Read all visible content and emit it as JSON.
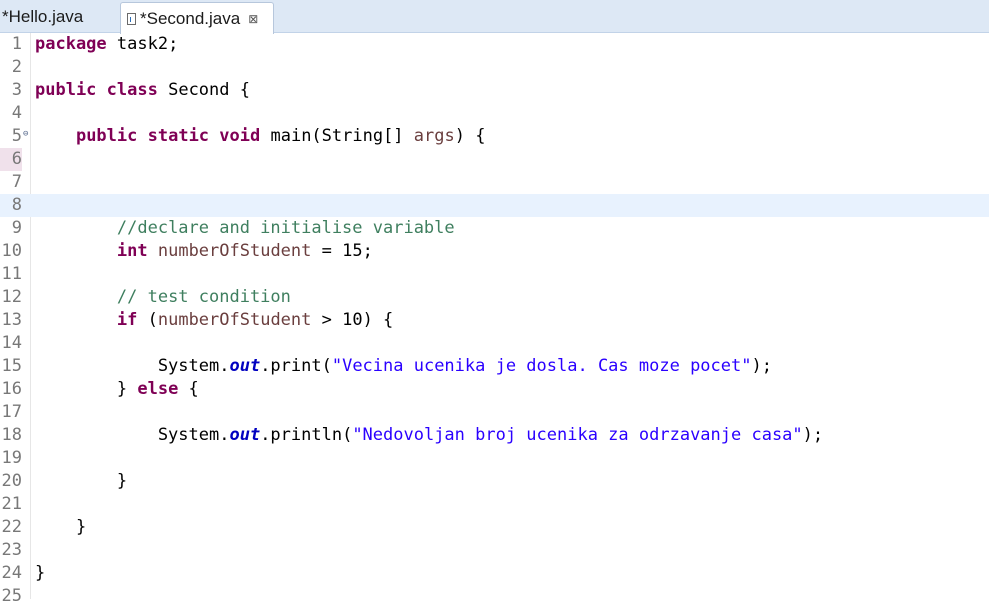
{
  "tabs": [
    {
      "label": "*Hello.java",
      "active": false
    },
    {
      "label": "*Second.java",
      "active": true,
      "close_glyph": "⊠"
    }
  ],
  "current_line": 8,
  "lines": [
    {
      "n": "1",
      "tokens": [
        {
          "t": "package",
          "c": "kw"
        },
        {
          "t": " task2;"
        }
      ]
    },
    {
      "n": "2",
      "tokens": []
    },
    {
      "n": "3",
      "tokens": [
        {
          "t": "public",
          "c": "kw"
        },
        {
          "t": " "
        },
        {
          "t": "class",
          "c": "kw"
        },
        {
          "t": " Second {"
        }
      ]
    },
    {
      "n": "4",
      "tokens": []
    },
    {
      "n": "5",
      "fold": "⊖",
      "tokens": [
        {
          "t": "    "
        },
        {
          "t": "public",
          "c": "kw"
        },
        {
          "t": " "
        },
        {
          "t": "static",
          "c": "kw"
        },
        {
          "t": " "
        },
        {
          "t": "void",
          "c": "kw"
        },
        {
          "t": " main(String[] "
        },
        {
          "t": "args",
          "c": "var"
        },
        {
          "t": ") {"
        }
      ]
    },
    {
      "n": "6",
      "mark": true,
      "tokens": []
    },
    {
      "n": "7",
      "tokens": []
    },
    {
      "n": "8",
      "tokens": []
    },
    {
      "n": "9",
      "tokens": [
        {
          "t": "        "
        },
        {
          "t": "//declare and initialise variable",
          "c": "cm"
        }
      ]
    },
    {
      "n": "10",
      "tokens": [
        {
          "t": "        "
        },
        {
          "t": "int",
          "c": "kw"
        },
        {
          "t": " "
        },
        {
          "t": "numberOfStudent",
          "c": "var"
        },
        {
          "t": " = 15;"
        }
      ]
    },
    {
      "n": "11",
      "tokens": []
    },
    {
      "n": "12",
      "tokens": [
        {
          "t": "        "
        },
        {
          "t": "// test condition",
          "c": "cm"
        }
      ]
    },
    {
      "n": "13",
      "tokens": [
        {
          "t": "        "
        },
        {
          "t": "if",
          "c": "kw"
        },
        {
          "t": " ("
        },
        {
          "t": "numberOfStudent",
          "c": "var"
        },
        {
          "t": " > 10) {"
        }
      ]
    },
    {
      "n": "14",
      "tokens": []
    },
    {
      "n": "15",
      "tokens": [
        {
          "t": "            System."
        },
        {
          "t": "out",
          "c": "fld"
        },
        {
          "t": ".print("
        },
        {
          "t": "\"Vecina ucenika je dosla. Cas moze pocet\"",
          "c": "str"
        },
        {
          "t": ");"
        }
      ]
    },
    {
      "n": "16",
      "tokens": [
        {
          "t": "        } "
        },
        {
          "t": "else",
          "c": "kw"
        },
        {
          "t": " {"
        }
      ]
    },
    {
      "n": "17",
      "tokens": []
    },
    {
      "n": "18",
      "tokens": [
        {
          "t": "            System."
        },
        {
          "t": "out",
          "c": "fld"
        },
        {
          "t": ".println("
        },
        {
          "t": "\"Nedovoljan broj ucenika za odrzavanje casa\"",
          "c": "str"
        },
        {
          "t": ");"
        }
      ]
    },
    {
      "n": "19",
      "tokens": []
    },
    {
      "n": "20",
      "tokens": [
        {
          "t": "        }"
        }
      ]
    },
    {
      "n": "21",
      "tokens": []
    },
    {
      "n": "22",
      "tokens": [
        {
          "t": "    }"
        }
      ]
    },
    {
      "n": "23",
      "tokens": []
    },
    {
      "n": "24",
      "tokens": [
        {
          "t": "}"
        }
      ]
    },
    {
      "n": "25",
      "tokens": []
    }
  ]
}
